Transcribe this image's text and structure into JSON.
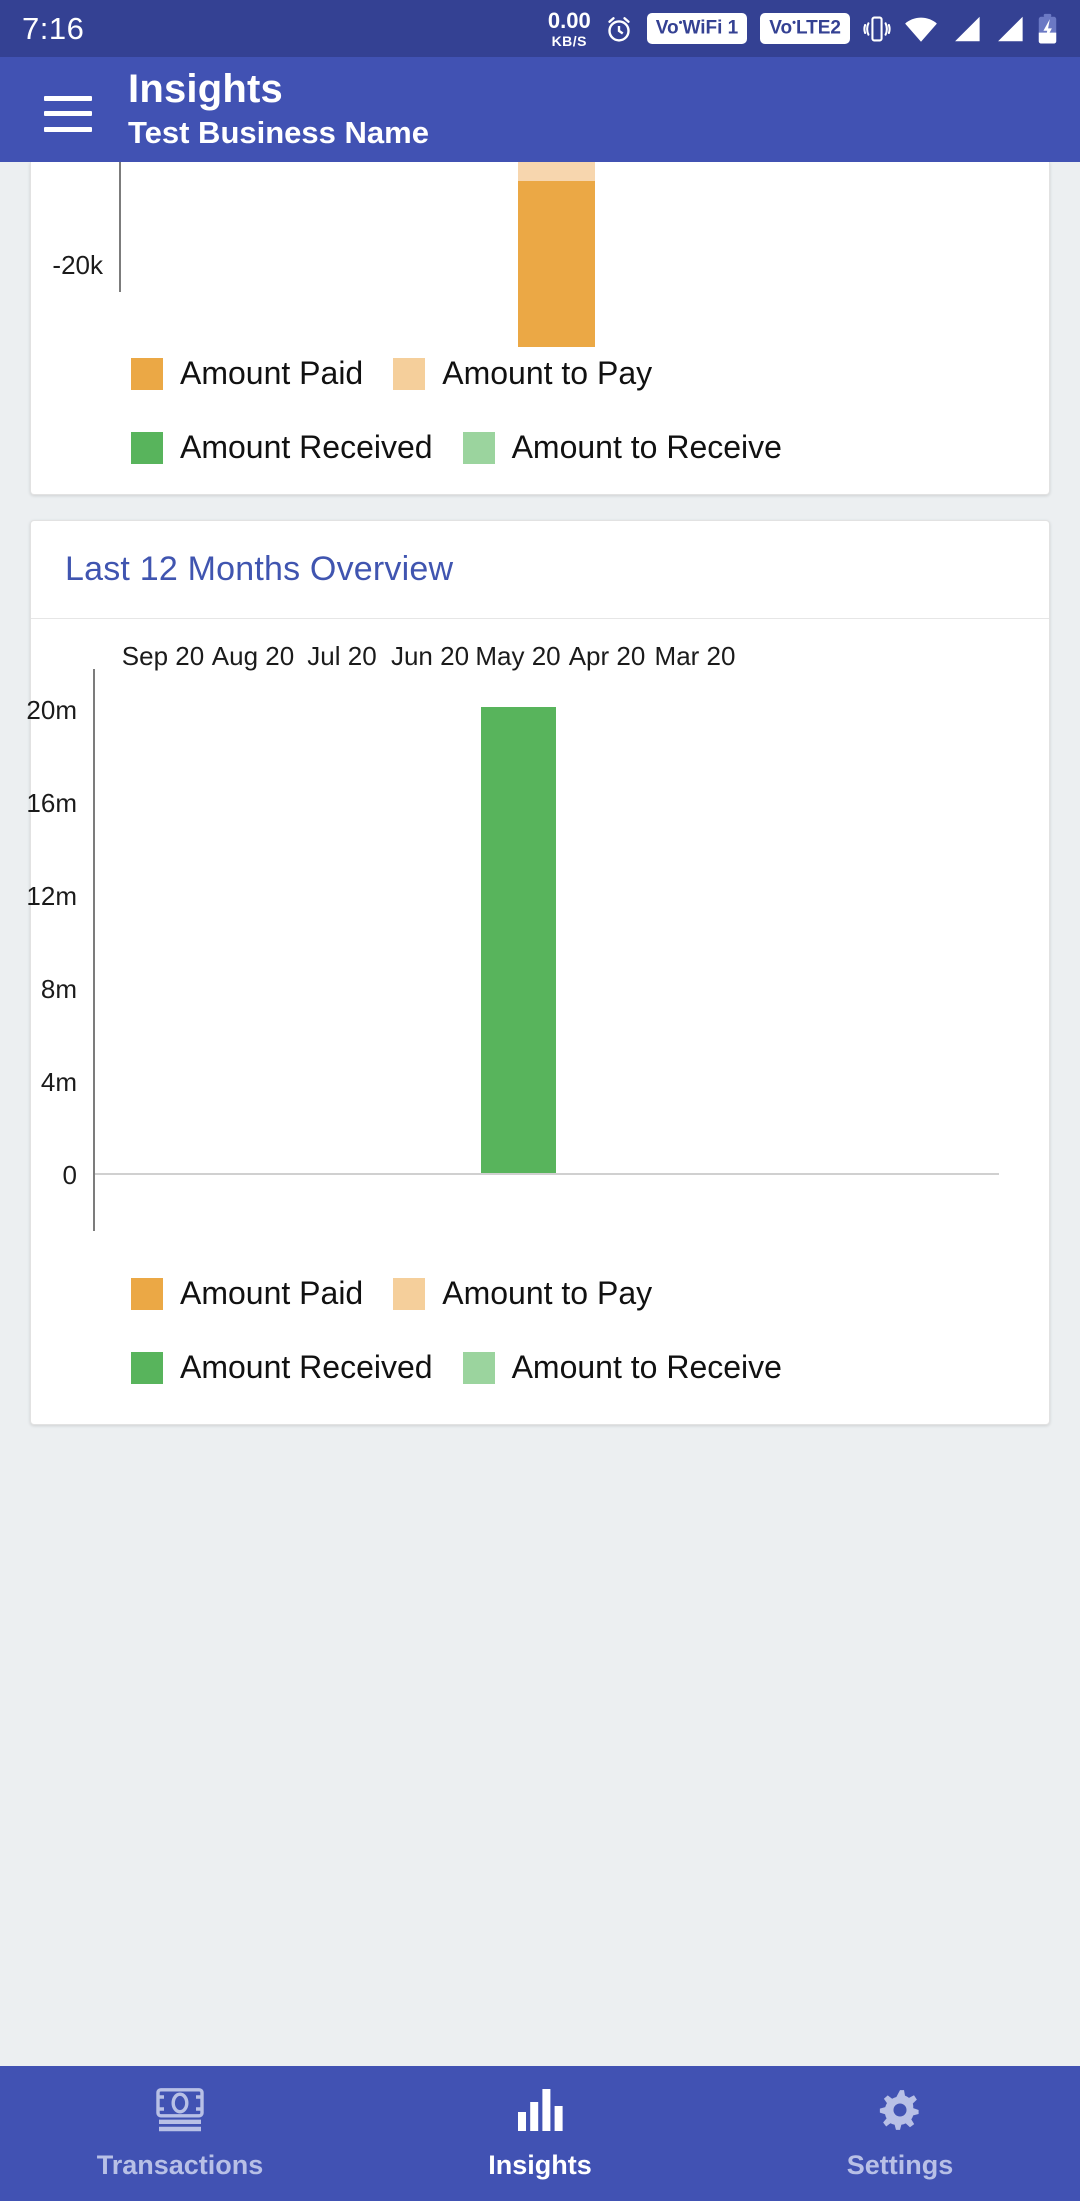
{
  "status_bar": {
    "time": "7:16",
    "network_speed_value": "0.00",
    "network_speed_unit": "KB/S",
    "alarm_icon": "alarm-clock-icon",
    "vowifi_label": "WiFi 1",
    "vowifi_prefix": "Vo",
    "volte_label": "LTE2",
    "volte_prefix": "Vo",
    "vibrate_icon": "vibrate-icon",
    "wifi_icon": "wifi-icon",
    "signal1_icon": "signal-bars-icon",
    "signal2_icon": "signal-bars-icon",
    "battery_icon": "battery-charging-icon"
  },
  "app_bar": {
    "menu_icon": "hamburger-menu-icon",
    "title": "Insights",
    "subtitle": "Test Business Name"
  },
  "legend_items": [
    {
      "label": "Amount Paid",
      "color": "#eba845"
    },
    {
      "label": "Amount to Pay",
      "color": "#f5cf9b"
    },
    {
      "label": "Amount Received",
      "color": "#58b45c"
    },
    {
      "label": "Amount to Receive",
      "color": "#9bd49e"
    }
  ],
  "card_top": {
    "ytick": "-20k"
  },
  "card_second": {
    "title": "Last 12 Months Overview"
  },
  "bottom_nav": {
    "items": [
      {
        "label": "Transactions",
        "icon": "money-note-icon",
        "active": false
      },
      {
        "label": "Insights",
        "icon": "bar-chart-icon",
        "active": true
      },
      {
        "label": "Settings",
        "icon": "gear-icon",
        "active": true
      }
    ]
  },
  "chart_data": [
    {
      "type": "bar",
      "title": "",
      "note": "Top card is scrolled off-screen; only the lower portion of the plot, the -20k y-tick and one orange stacked bar are visible.",
      "categories": [
        "(visible bar)"
      ],
      "series": [
        {
          "name": "Amount Paid",
          "color": "#eba845",
          "values": [
            -20000
          ]
        },
        {
          "name": "Amount to Pay",
          "color": "#f5cf9b",
          "values": [
            -2000
          ]
        }
      ],
      "yticks_visible": [
        "-20k"
      ],
      "xlabel": "",
      "ylabel": "",
      "grid": false,
      "legend_position": "bottom"
    },
    {
      "type": "bar",
      "title": "Last 12 Months Overview",
      "categories": [
        "Sep 20",
        "Aug 20",
        "Jul 20",
        "Jun 20",
        "May 20",
        "Apr 20",
        "Mar 20"
      ],
      "series": [
        {
          "name": "Amount Paid",
          "color": "#eba845",
          "values": [
            0,
            0,
            0,
            0,
            0,
            0,
            0
          ]
        },
        {
          "name": "Amount to Pay",
          "color": "#f5cf9b",
          "values": [
            0,
            0,
            0,
            0,
            0,
            0,
            0
          ]
        },
        {
          "name": "Amount Received",
          "color": "#58b45c",
          "values": [
            0,
            0,
            0,
            0,
            20000000,
            0,
            0
          ]
        },
        {
          "name": "Amount to Receive",
          "color": "#9bd49e",
          "values": [
            0,
            0,
            0,
            0,
            0,
            0,
            0
          ]
        }
      ],
      "yticks": [
        "0",
        "4m",
        "8m",
        "12m",
        "16m",
        "20m"
      ],
      "ylim": [
        0,
        20000000
      ],
      "xlabel": "",
      "ylabel": "",
      "grid": false,
      "legend_position": "bottom"
    }
  ]
}
